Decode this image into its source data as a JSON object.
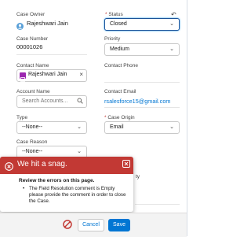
{
  "form": {
    "case_owner": {
      "label": "Case Owner",
      "value": "Rajeshwari Jain"
    },
    "status": {
      "label": "Status",
      "value": "Closed"
    },
    "case_number": {
      "label": "Case Number",
      "value": "00001026"
    },
    "priority": {
      "label": "Priority",
      "value": "Medium"
    },
    "contact_name": {
      "label": "Contact Name",
      "value": "Rajeshwari Jain"
    },
    "contact_phone": {
      "label": "Contact Phone"
    },
    "account_name": {
      "label": "Account Name",
      "placeholder": "Search Accounts..."
    },
    "contact_email": {
      "label": "Contact Email",
      "value": "rsalesforce15@gmail.com"
    },
    "type": {
      "label": "Type",
      "value": "--None--"
    },
    "case_origin": {
      "label": "Case Origin",
      "value": "Email"
    },
    "case_reason": {
      "label": "Case Reason",
      "value": "--None--"
    },
    "partial_right_label": "ty"
  },
  "error": {
    "title": "We hit a snag.",
    "heading": "Review the errors on this page.",
    "message": "The Field Resolution comment is Empty please provide the comment in order to close the Case."
  },
  "footer": {
    "cancel_label": "Cancel",
    "save_label": "Save"
  },
  "colors": {
    "error_red": "#c23934",
    "brand_blue": "#0176d3"
  }
}
